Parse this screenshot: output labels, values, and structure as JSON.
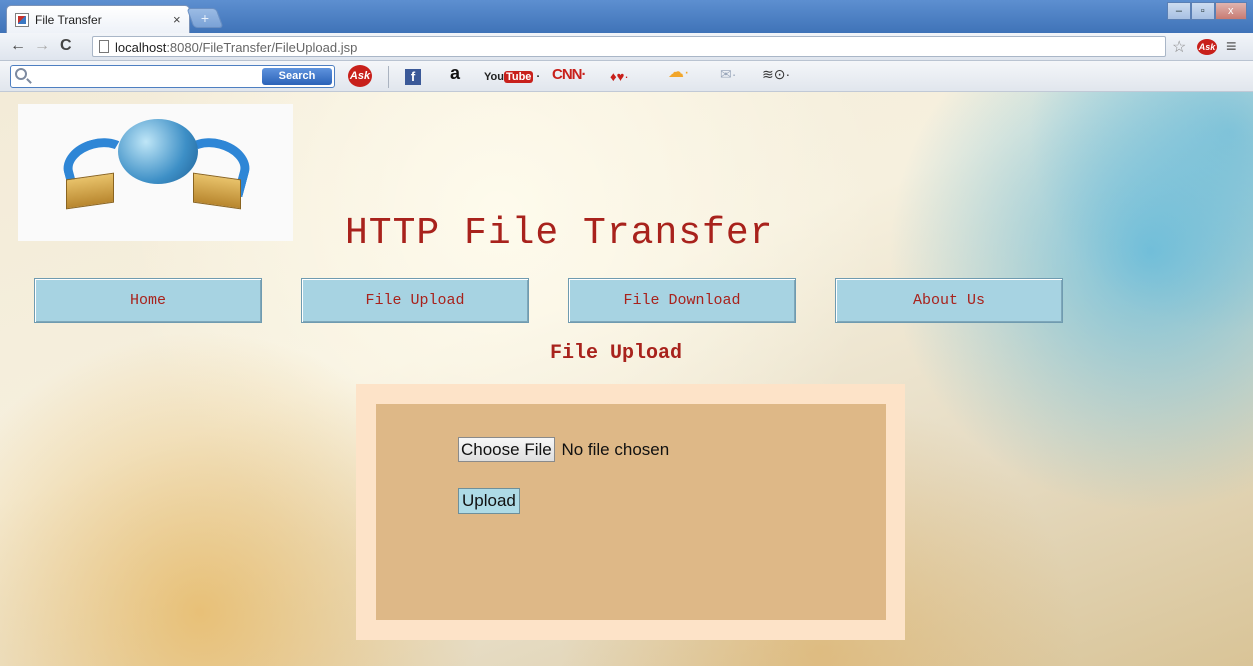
{
  "browser": {
    "tab_title": "File Transfer",
    "tab_close": "×",
    "new_tab": "+",
    "window_controls": [
      "–",
      "▫",
      "x"
    ],
    "url_host": "localhost",
    "url_rest": ":8080/FileTransfer/FileUpload.jsp"
  },
  "toolbar": {
    "search_button": "Search",
    "ask": "Ask",
    "facebook": "f",
    "amazon": "a",
    "youtube_you": "You",
    "youtube_tube": "Tube",
    "cnn": "CNN·",
    "dice": "♦♥·",
    "weather": "☁·",
    "mail": "✉·",
    "misc": "≋⊙·"
  },
  "page": {
    "site_title": "HTTP File Transfer",
    "nav": [
      "Home",
      "File Upload",
      "File Download",
      "About Us"
    ],
    "section_title": "File Upload",
    "choose_file": "Choose File",
    "no_file": "No file chosen",
    "upload": "Upload"
  },
  "colors": {
    "title_red": "#a8221c",
    "nav_blue": "#a7d3e2",
    "panel_outer": "#fde3c8",
    "panel_inner": "#deb887"
  }
}
